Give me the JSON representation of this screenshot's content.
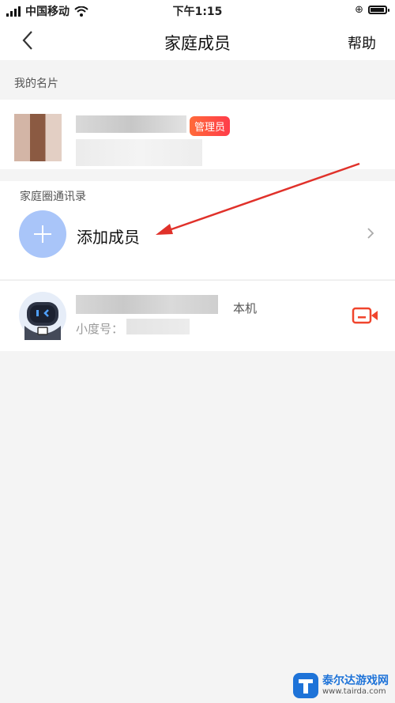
{
  "status": {
    "carrier": "中国移动",
    "time": "下午1:15"
  },
  "nav": {
    "title": "家庭成员",
    "help": "帮助"
  },
  "my_card": {
    "section_label": "我的名片",
    "badge": "管理员"
  },
  "contacts": {
    "section_label": "家庭圈通讯录",
    "add_label": "添加成员",
    "members": [
      {
        "device_tag": "本机",
        "id_prefix": "小度号："
      }
    ]
  },
  "watermark": {
    "site": "泰尔达游戏网",
    "url": "www.tairda.com"
  },
  "colors": {
    "accent_blue": "#a9c5f9",
    "badge": "#ff4a3d",
    "arrow": "#e0312a",
    "video_icon": "#f0452d"
  }
}
